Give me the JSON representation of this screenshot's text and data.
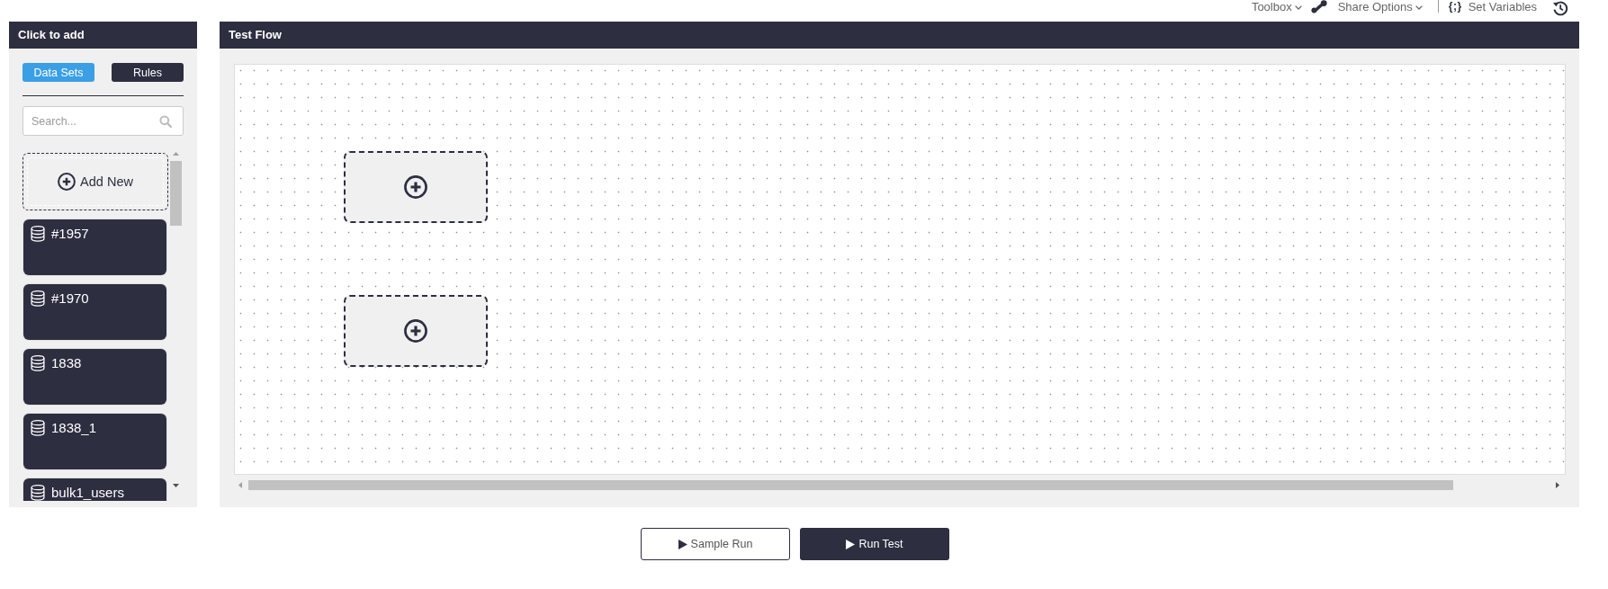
{
  "toolbar": {
    "items": [
      {
        "kind": "menu",
        "label": "Toolbox"
      },
      {
        "kind": "share_menu",
        "label": "Share Options"
      },
      {
        "kind": "variables",
        "glyph": "{;}",
        "label": "Set Variables"
      },
      {
        "kind": "history"
      }
    ]
  },
  "palette": {
    "title": "Click to add",
    "tabs": [
      {
        "label": "Data Sets",
        "selected": true
      },
      {
        "label": "Rules",
        "selected": false
      }
    ],
    "search": {
      "placeholder": "Search..."
    },
    "add_new": {
      "label": "Add New"
    },
    "items": [
      {
        "label": "#1957"
      },
      {
        "label": "#1970"
      },
      {
        "label": "1838"
      },
      {
        "label": "1838_1"
      },
      {
        "label": "bulk1_users"
      }
    ]
  },
  "flow": {
    "title": "Test Flow",
    "nodes": [
      {
        "kind": "empty_slot"
      },
      {
        "kind": "empty_slot"
      }
    ]
  },
  "actions": [
    {
      "kind": "secondary",
      "label": "Sample Run"
    },
    {
      "kind": "primary",
      "label": "Run Test"
    }
  ]
}
